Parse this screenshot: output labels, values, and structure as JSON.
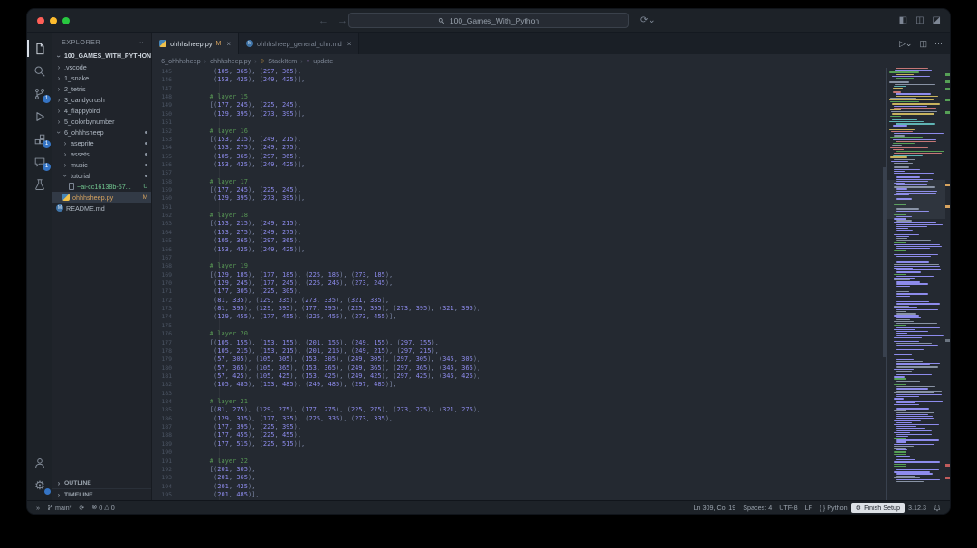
{
  "titlebar": {
    "search": "100_Games_With_Python"
  },
  "activity_bar": {
    "badges": {
      "scm": "1",
      "extensions": "1",
      "chat": "1"
    }
  },
  "explorer": {
    "title": "EXPLORER",
    "root": "100_GAMES_WITH_PYTHON",
    "items": [
      {
        "chevron": "right",
        "label": ".vscode",
        "level": 1,
        "type": "folder"
      },
      {
        "chevron": "right",
        "label": "1_snake",
        "level": 1,
        "type": "folder"
      },
      {
        "chevron": "right",
        "label": "2_tetris",
        "level": 1,
        "type": "folder"
      },
      {
        "chevron": "right",
        "label": "3_candycrush",
        "level": 1,
        "type": "folder"
      },
      {
        "chevron": "right",
        "label": "4_flappybird",
        "level": 1,
        "type": "folder"
      },
      {
        "chevron": "right",
        "label": "5_colorbynumber",
        "level": 1,
        "type": "folder"
      },
      {
        "chevron": "down",
        "label": "6_ohhhsheep",
        "level": 1,
        "type": "folder",
        "dot": true
      },
      {
        "chevron": "right",
        "label": "aseprite",
        "level": 2,
        "type": "folder",
        "dot": true
      },
      {
        "chevron": "right",
        "label": "assets",
        "level": 2,
        "type": "folder",
        "dot": true
      },
      {
        "chevron": "right",
        "label": "music",
        "level": 2,
        "type": "folder",
        "dot": true
      },
      {
        "chevron": "down",
        "label": "tutorial",
        "level": 2,
        "type": "folder",
        "dot": true
      },
      {
        "label": "~ai-cc16138b-57...",
        "level": 3,
        "type": "file",
        "icon": "file",
        "badge": "U",
        "state": "untracked"
      },
      {
        "label": "ohhhsheep.py",
        "level": 2,
        "type": "file",
        "icon": "python",
        "badge": "M",
        "state": "modified",
        "selected": true
      },
      {
        "label": "README.md",
        "level": 1,
        "type": "file",
        "icon": "markdown"
      }
    ],
    "panels": [
      "OUTLINE",
      "TIMELINE"
    ]
  },
  "tabs": [
    {
      "label": "ohhhsheep.py",
      "icon": "python",
      "badge": "M",
      "active": true
    },
    {
      "label": "ohhhsheep_general_chn.md",
      "icon": "markdown",
      "active": false
    }
  ],
  "breadcrumbs": {
    "items": [
      "6_ohhhsheep",
      "ohhhsheep.py",
      "StackItem",
      "update"
    ]
  },
  "code": {
    "lines": [
      [
        145,
        "         (105, 365), (297, 365),"
      ],
      [
        146,
        "         (153, 425), (249, 425)],"
      ],
      [
        147,
        ""
      ],
      [
        148,
        "        # layer 15"
      ],
      [
        149,
        "        [(177, 245), (225, 245),"
      ],
      [
        150,
        "         (129, 395), (273, 395)],"
      ],
      [
        151,
        ""
      ],
      [
        152,
        "        # layer 16"
      ],
      [
        153,
        "        [(153, 215), (249, 215),"
      ],
      [
        154,
        "         (153, 275), (249, 275),"
      ],
      [
        155,
        "         (105, 365), (297, 365),"
      ],
      [
        156,
        "         (153, 425), (249, 425)],"
      ],
      [
        157,
        ""
      ],
      [
        158,
        "        # layer 17"
      ],
      [
        159,
        "        [(177, 245), (225, 245),"
      ],
      [
        160,
        "         (129, 395), (273, 395)],"
      ],
      [
        161,
        ""
      ],
      [
        162,
        "        # layer 18"
      ],
      [
        163,
        "        [(153, 215), (249, 215),"
      ],
      [
        164,
        "         (153, 275), (249, 275),"
      ],
      [
        165,
        "         (105, 365), (297, 365),"
      ],
      [
        166,
        "         (153, 425), (249, 425)],"
      ],
      [
        167,
        ""
      ],
      [
        168,
        "        # layer 19"
      ],
      [
        169,
        "        [(129, 185), (177, 185), (225, 185), (273, 185),"
      ],
      [
        170,
        "         (129, 245), (177, 245), (225, 245), (273, 245),"
      ],
      [
        171,
        "         (177, 305), (225, 305),"
      ],
      [
        172,
        "         (81, 335), (129, 335), (273, 335), (321, 335),"
      ],
      [
        173,
        "         (81, 395), (129, 395), (177, 395), (225, 395), (273, 395), (321, 395),"
      ],
      [
        174,
        "         (129, 455), (177, 455), (225, 455), (273, 455)],"
      ],
      [
        175,
        ""
      ],
      [
        176,
        "        # layer 20"
      ],
      [
        177,
        "        [(105, 155), (153, 155), (201, 155), (249, 155), (297, 155),"
      ],
      [
        178,
        "         (105, 215), (153, 215), (201, 215), (249, 215), (297, 215),"
      ],
      [
        179,
        "         (57, 305), (105, 305), (153, 305), (249, 305), (297, 305), (345, 305),"
      ],
      [
        180,
        "         (57, 365), (105, 365), (153, 365), (249, 365), (297, 365), (345, 365),"
      ],
      [
        181,
        "         (57, 425), (105, 425), (153, 425), (249, 425), (297, 425), (345, 425),"
      ],
      [
        182,
        "         (105, 485), (153, 485), (249, 485), (297, 485)],"
      ],
      [
        183,
        ""
      ],
      [
        184,
        "        # layer 21"
      ],
      [
        185,
        "        [(81, 275), (129, 275), (177, 275), (225, 275), (273, 275), (321, 275),"
      ],
      [
        186,
        "         (129, 335), (177, 335), (225, 335), (273, 335),"
      ],
      [
        187,
        "         (177, 395), (225, 395),"
      ],
      [
        188,
        "         (177, 455), (225, 455),"
      ],
      [
        189,
        "         (177, 515), (225, 515)],"
      ],
      [
        190,
        ""
      ],
      [
        191,
        "        # layer 22"
      ],
      [
        192,
        "        [(201, 305),"
      ],
      [
        193,
        "         (201, 365),"
      ],
      [
        194,
        "         (201, 425),"
      ],
      [
        195,
        "         (201, 485)],"
      ]
    ]
  },
  "status_bar": {
    "branch": "main*",
    "errors": "0",
    "warnings": "0",
    "line_col": "Ln 309, Col 19",
    "spaces": "Spaces: 4",
    "encoding": "UTF-8",
    "eol": "LF",
    "language": "Python",
    "finish_setup": "Finish Setup",
    "python_version": "3.12.3"
  }
}
